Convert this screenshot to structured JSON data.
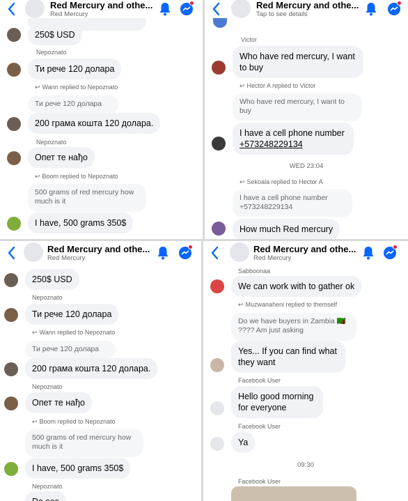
{
  "panels": {
    "tl": {
      "header": {
        "title": "Red Mercury and othe...",
        "subtitle": "Red Mercury"
      },
      "messages": {
        "m1": "250$ USD",
        "s2": "Nepoznato",
        "m2": "Ти рече 120 долара",
        "r3": "Wann replied to Nepoznato",
        "q3": "Ти рече 120 долара",
        "m3": "200 грама кошта 120 долара.",
        "s4": "Nepoznato",
        "m4": "Опет те нађо",
        "r5": "Boom replied to Nepoznato",
        "q5": "500 grams of red mercury how much is it",
        "m5": "I have, 500 grams 350$"
      }
    },
    "tr": {
      "header": {
        "title": "Red Mercury and othe...",
        "subtitle": "Tap to see details"
      },
      "messages": {
        "s1": "Victor",
        "m1": "Who have red mercury, I want to buy",
        "r2": "Hector A replied to Victor",
        "q2": "Who have red mercury, I want to buy",
        "m2a": "I have a cell phone number",
        "m2b": "+573248229134",
        "time": "WED 23:04",
        "r3": "Sekoala replied to Hector A",
        "q3": "I have a cell phone number +573248229134",
        "m3": "How much Red mercury"
      }
    },
    "bl": {
      "header": {
        "title": "Red Mercury and othe...",
        "subtitle": "Red Mercury"
      },
      "messages": {
        "m1": "250$ USD",
        "s2": "Nepoznato",
        "m2": "Ти рече 120 долара",
        "r3": "Wann replied to Nepoznato",
        "q3": "Ти рече 120 долара",
        "m3": "200 грама кошта 120 долара.",
        "s4": "Nepoznato",
        "m4": "Опет те нађо",
        "r5": "Boom replied to Nepoznato",
        "q5": "500 grams of red mercury how much is it",
        "m5": "I have, 500 grams 350$",
        "s6": "Nepoznato",
        "m6": "Da ses"
      }
    },
    "br": {
      "header": {
        "title": "Red Mercury and othe...",
        "subtitle": "Red Mercury"
      },
      "messages": {
        "s1": "Sabboonaa",
        "m1": "We can work with to gather ok",
        "r2": "Muzwanaheni replied to themself",
        "q2": "Do we have buyers in Zambia 🇿🇲 ???? Am just asking",
        "m2": "Yes... If you can find what they want",
        "s3": "Facebook User",
        "m3": "Hello good morning for everyone",
        "s4": "Facebook User",
        "m4": "Ya",
        "time": "09:30",
        "s5": "Facebook User"
      }
    }
  },
  "colors": {
    "accent": "#0866ff",
    "bubble": "#f0f2f5",
    "badge": "#e41e3f"
  }
}
